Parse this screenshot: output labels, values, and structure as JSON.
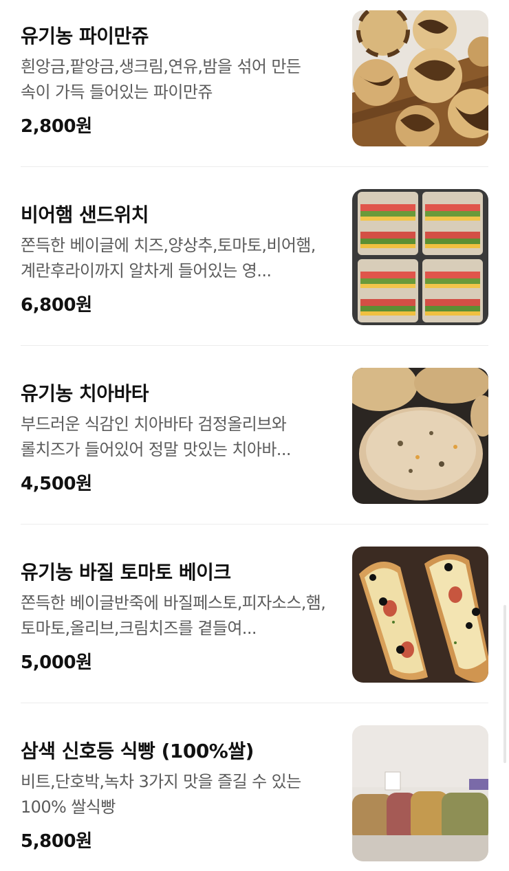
{
  "menu": {
    "items": [
      {
        "name": "유기농 파이만쥬",
        "description": "흰앙금,팥앙금,생크림,연유,밤을 섞어 만든 속이 가득 들어있는 파이만쥬",
        "price": "2,800원",
        "image_icon": "pie-manju-photo"
      },
      {
        "name": "비어햄 샌드위치",
        "description": "쫀득한 베이글에 치즈,양상추,토마토,비어햄,계란후라이까지 알차게 들어있는 영...",
        "price": "6,800원",
        "image_icon": "sandwich-photo"
      },
      {
        "name": "유기농 치아바타",
        "description": "부드러운 식감인 치아바타 검정올리브와 롤치즈가 들어있어 정말 맛있는 치아바...",
        "price": "4,500원",
        "image_icon": "ciabatta-photo"
      },
      {
        "name": "유기농 바질 토마토 베이크",
        "description": "쫀득한 베이글반죽에 바질페스토,피자소스,햄,토마토,올리브,크림치즈를 곁들여...",
        "price": "5,000원",
        "image_icon": "basil-tomato-bake-photo"
      },
      {
        "name": "삼색 신호등 식빵 (100%쌀)",
        "description": "비트,단호박,녹차 3가지 맛을 즐길 수 있는 100% 쌀식빵",
        "price": "5,800원",
        "image_icon": "tricolor-bread-photo"
      }
    ]
  },
  "colors": {
    "name_text": "#111111",
    "description_text": "#5b5b5b",
    "divider": "#ececec"
  }
}
